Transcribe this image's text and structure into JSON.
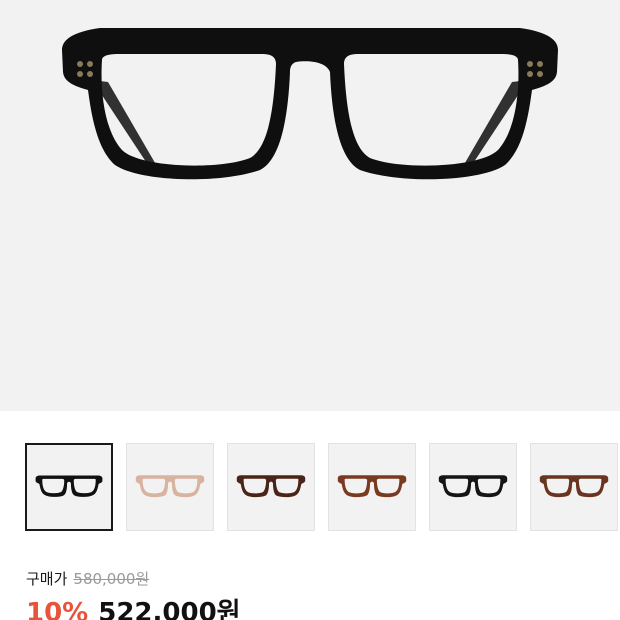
{
  "product": {
    "main_image_icon": "glasses-icon",
    "frame_color": "#0f0f0f"
  },
  "thumbnails": [
    {
      "icon": "glasses-icon",
      "frame_color": "#111111",
      "lens_tint": "#f2f2f2",
      "selected": true
    },
    {
      "icon": "glasses-icon",
      "frame_color": "#d7b3a0",
      "lens_tint": "#f2f2f2",
      "selected": false
    },
    {
      "icon": "glasses-icon",
      "frame_color": "#4a2418",
      "lens_tint": "#f2f2f2",
      "selected": false
    },
    {
      "icon": "glasses-icon",
      "frame_color": "#7a3a20",
      "lens_tint": "#f2f2f2",
      "selected": false
    },
    {
      "icon": "glasses-icon",
      "frame_color": "#151515",
      "lens_tint": "#f2f2f2",
      "selected": false
    },
    {
      "icon": "glasses-icon",
      "frame_color": "#6a3420",
      "lens_tint": "#f2f2f2",
      "selected": false
    }
  ],
  "price": {
    "label": "구매가",
    "original": "580,000원",
    "discount": "10%",
    "sale": "522,000원"
  },
  "colors": {
    "discount": "#e8533b",
    "background": "#f2f2f2"
  }
}
